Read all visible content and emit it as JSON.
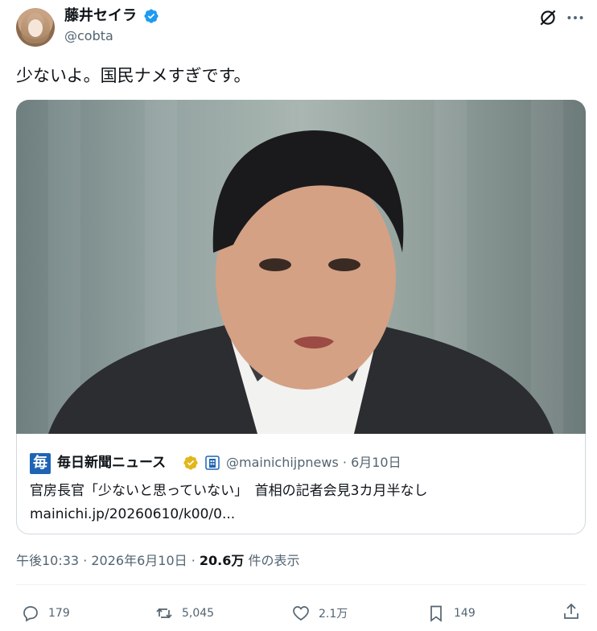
{
  "author": {
    "display_name": "藤井セイラ",
    "handle": "@cobta"
  },
  "tweet": {
    "text": "少ないよ。国民ナメすぎです。"
  },
  "quote": {
    "logo_text": "毎",
    "name": "毎日新聞ニュース",
    "handle_date": "@mainichijpnews · 6月10日",
    "text": "官房長官「少ないと思っていない」　首相の記者会見3カ月半なし",
    "link": "mainichi.jp/20260610/k00/0..."
  },
  "meta": {
    "time_date": "午後10:33 · 2026年6月10日 · ",
    "views": "20.6万",
    "views_suffix": " 件の表示"
  },
  "actions": {
    "replies": "179",
    "reposts": "5,045",
    "likes": "2.1万",
    "bookmarks": "149"
  },
  "colors": {
    "verified_blue": "#1d9bf0",
    "gold_badge": "#e2b719",
    "secondary_text": "#536471"
  }
}
